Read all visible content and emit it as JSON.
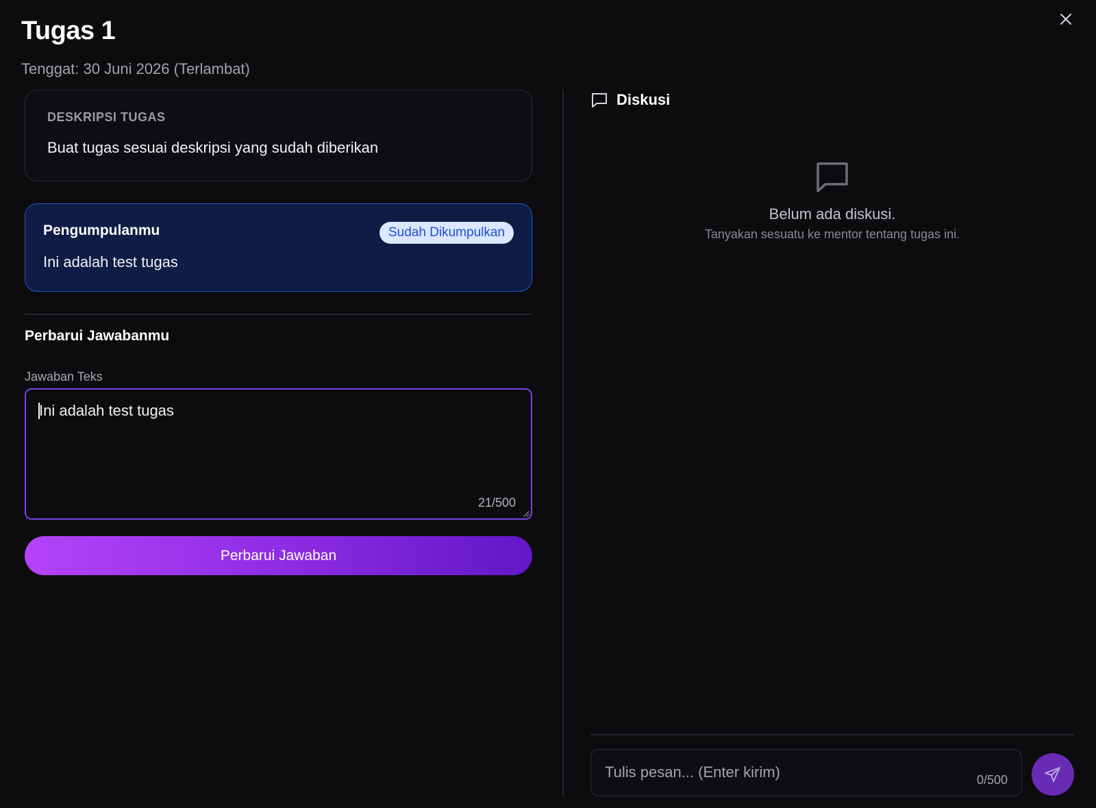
{
  "header": {
    "title": "Tugas 1",
    "deadline": "Tenggat: 30 Juni 2026 (Terlambat)",
    "close_icon": "close-icon"
  },
  "description": {
    "label": "DESKRIPSI TUGAS",
    "text": "Buat tugas sesuai deskripsi yang sudah diberikan"
  },
  "submission": {
    "title": "Pengumpulanmu",
    "status": "Sudah Dikumpulkan",
    "text": "Ini adalah test tugas"
  },
  "update_form": {
    "title": "Perbarui Jawabanmu",
    "field_label": "Jawaban Teks",
    "value": "Ini adalah test tugas",
    "char_count": "21/500",
    "submit_label": "Perbarui Jawaban"
  },
  "discussion": {
    "title": "Diskusi",
    "icon": "chat-bubble-icon",
    "empty_title": "Belum ada diskusi.",
    "empty_subtitle": "Tanyakan sesuatu ke mentor tentang tugas ini.",
    "input_placeholder": "Tulis pesan... (Enter kirim)",
    "input_count": "0/500",
    "send_icon": "send-icon"
  },
  "colors": {
    "background": "#0c0c0f",
    "accent_purple": "#8a2be2",
    "submission_border": "#2554d6",
    "badge_bg": "#dbe7ff",
    "badge_text": "#1f4fd4"
  }
}
